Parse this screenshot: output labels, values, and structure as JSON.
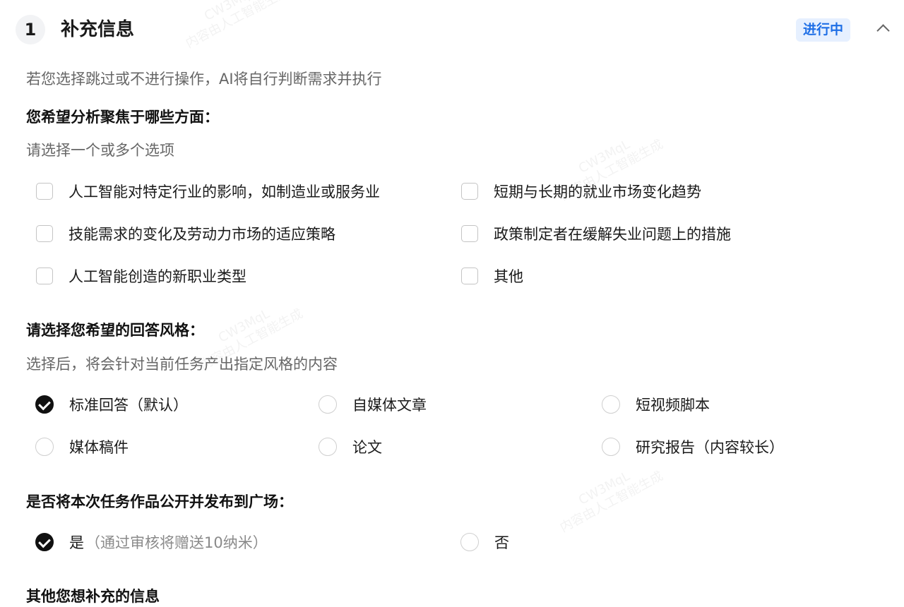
{
  "header": {
    "step_number": "1",
    "title": "补充信息",
    "status": "进行中"
  },
  "intro_hint": "若您选择跳过或不进行操作，AI将自行判断需求并执行",
  "q1": {
    "title": "您希望分析聚焦于哪些方面：",
    "hint": "请选择一个或多个选项",
    "options": [
      {
        "label": "人工智能对特定行业的影响，如制造业或服务业",
        "checked": false
      },
      {
        "label": "短期与长期的就业市场变化趋势",
        "checked": false
      },
      {
        "label": "技能需求的变化及劳动力市场的适应策略",
        "checked": false
      },
      {
        "label": "政策制定者在缓解失业问题上的措施",
        "checked": false
      },
      {
        "label": "人工智能创造的新职业类型",
        "checked": false
      },
      {
        "label": "其他",
        "checked": false
      }
    ]
  },
  "q2": {
    "title": "请选择您希望的回答风格：",
    "hint": "选择后，将会针对当前任务产出指定风格的内容",
    "options": [
      {
        "label": "标准回答（默认）",
        "selected": true
      },
      {
        "label": "自媒体文章",
        "selected": false
      },
      {
        "label": "短视频脚本",
        "selected": false
      },
      {
        "label": "媒体稿件",
        "selected": false
      },
      {
        "label": "论文",
        "selected": false
      },
      {
        "label": "研究报告（内容较长）",
        "selected": false
      }
    ]
  },
  "q3": {
    "title": "是否将本次任务作品公开并发布到广场：",
    "options": [
      {
        "label": "是",
        "sub": "（通过审核将赠送10纳米）",
        "selected": true
      },
      {
        "label": "否",
        "sub": "",
        "selected": false
      }
    ]
  },
  "q4": {
    "title": "其他您想补充的信息"
  },
  "watermark": {
    "line1": "CW3MqL",
    "line2": "内容由人工智能生成"
  },
  "colors": {
    "accent": "#1f6fe6",
    "status_bg": "#e6f0ff",
    "checked": "#111111"
  }
}
